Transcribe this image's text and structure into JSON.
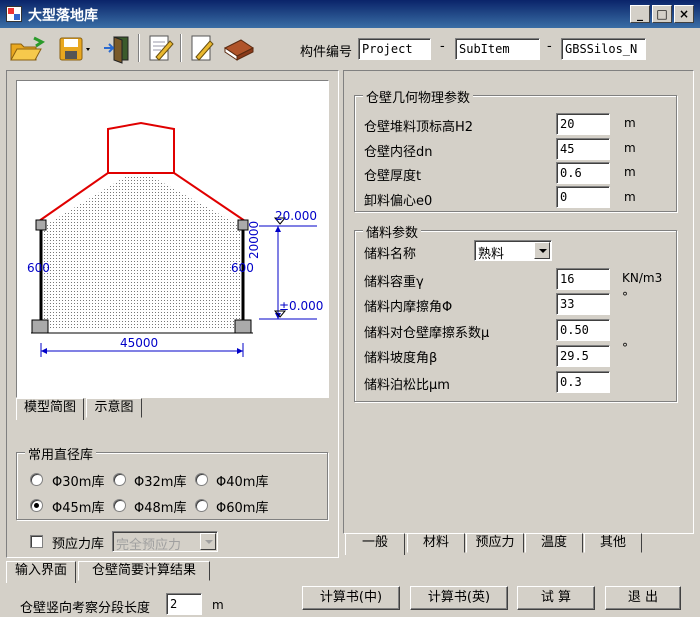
{
  "window": {
    "title": "大型落地库"
  },
  "toolbar": {
    "component_label": "构件编号",
    "project": "Project",
    "sub_item": "SubItem",
    "component": "GBSSilos_N",
    "dash": "-"
  },
  "diagram": {
    "top_elev": "20.000",
    "zero_elev": "±0.000",
    "height": "20000",
    "diameter": "45000",
    "left_wall": "600",
    "right_wall": "600"
  },
  "left_tabs": {
    "model": "模型简图",
    "schematic": "示意图"
  },
  "diam_group": {
    "title": "常用直径库",
    "options": [
      "Φ30m库",
      "Φ32m库",
      "Φ40m库",
      "Φ45m库",
      "Φ48m库",
      "Φ60m库"
    ],
    "selected": "Φ45m库"
  },
  "prestress": {
    "label": "预应力库",
    "value": "完全预应力"
  },
  "geom": {
    "title": "仓壁几何物理参数",
    "rows": [
      {
        "label": "仓壁堆料顶标高H2",
        "value": "20",
        "unit": "m"
      },
      {
        "label": "仓壁内径dn",
        "value": "45",
        "unit": "m"
      },
      {
        "label": "仓壁厚度t",
        "value": "0.6",
        "unit": "m"
      },
      {
        "label": "卸料偏心e0",
        "value": "0",
        "unit": "m"
      }
    ]
  },
  "material": {
    "title": "储料参数",
    "name_label": "储料名称",
    "name_value": "熟料",
    "rows": [
      {
        "label": "储料容重γ",
        "value": "16",
        "unit": "KN/m3"
      },
      {
        "label": "储料内摩擦角Φ",
        "value": "33",
        "unit": "°"
      },
      {
        "label": "储料对仓壁摩擦系数μ",
        "value": "0.50",
        "unit": ""
      },
      {
        "label": "储料坡度角β",
        "value": "29.5",
        "unit": "°"
      },
      {
        "label": "储料泊松比μm",
        "value": "0.3",
        "unit": ""
      }
    ]
  },
  "right_tabs": [
    "一般",
    "材料",
    "预应力",
    "温度",
    "其他"
  ],
  "bottom_tabs": {
    "input": "输入界面",
    "results": "仓壁简要计算结果"
  },
  "bottom": {
    "seg_label": "仓壁竖向考察分段长度",
    "seg_value": "2",
    "seg_unit": "m",
    "btn_report_cn": "计算书(中)",
    "btn_report_en": "计算书(英)",
    "btn_trial": "试  算",
    "btn_exit": "退  出"
  },
  "colors": {
    "title_start": "#0a246a",
    "title_end": "#3a6ea5",
    "roof": "#e00000",
    "diagram_blue": "#0000c8"
  }
}
